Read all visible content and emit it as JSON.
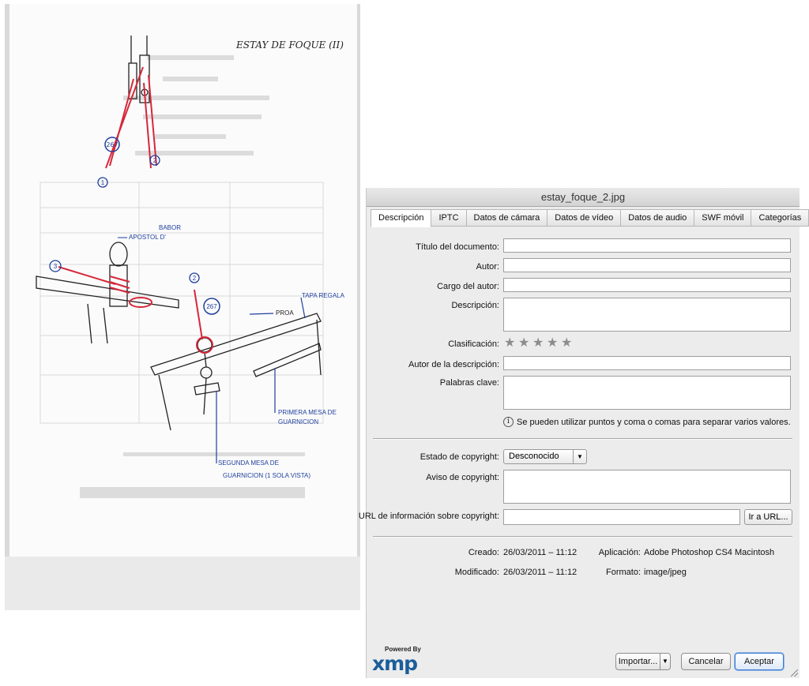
{
  "sketch": {
    "title": "ESTAY DE FOQUE (II)",
    "labels": {
      "babor": "BABOR",
      "apostol": "APOSTOL D'",
      "tapa_regala": "TAPA REGALA",
      "proa": "PROA",
      "primera_mesa_1": "PRIMERA MESA DE",
      "primera_mesa_2": "GUARNICION",
      "segunda_mesa_1": "SEGUNDA MESA DE",
      "segunda_mesa_2": "GUARNICION (1 SOLA VISTA)"
    },
    "marks": {
      "n267": "267",
      "n1": "1",
      "n2": "2",
      "n3": "3"
    }
  },
  "dialog": {
    "title": "estay_foque_2.jpg",
    "tabs": [
      "Descripción",
      "IPTC",
      "Datos de cámara",
      "Datos de vídeo",
      "Datos de audio",
      "SWF móvil",
      "Categorías"
    ],
    "active_tab": "Descripción",
    "fields": {
      "document_title_label": "Título del documento:",
      "author_label": "Autor:",
      "author_position_label": "Cargo del autor:",
      "description_label": "Descripción:",
      "rating_label": "Clasificación:",
      "description_author_label": "Autor de la descripción:",
      "keywords_label": "Palabras clave:"
    },
    "rating": {
      "value": 0,
      "max": 5
    },
    "keywords_hint": "Se pueden utilizar puntos y coma o comas para separar varios valores.",
    "copyright": {
      "status_label": "Estado de copyright:",
      "status_value": "Desconocido",
      "notice_label": "Aviso de copyright:",
      "url_label": "URL de información sobre copyright:",
      "goto_url_label": "Ir a URL..."
    },
    "meta": {
      "created_label": "Creado:",
      "created_value": "26/03/2011 – 11:12",
      "modified_label": "Modificado:",
      "modified_value": "26/03/2011 – 11:12",
      "application_label": "Aplicación:",
      "application_value": "Adobe Photoshop CS4 Macintosh",
      "format_label": "Formato:",
      "format_value": "image/jpeg"
    },
    "logo": {
      "powered_by": "Powered By",
      "word": "xmp"
    },
    "buttons": {
      "import": "Importar...",
      "cancel": "Cancelar",
      "accept": "Aceptar"
    }
  },
  "colors": {
    "ink_blue": "#1f3f9e",
    "ink_red": "#d6283a",
    "xmp_blue": "#1b5e9a",
    "focus_blue": "#3d7ad0"
  }
}
